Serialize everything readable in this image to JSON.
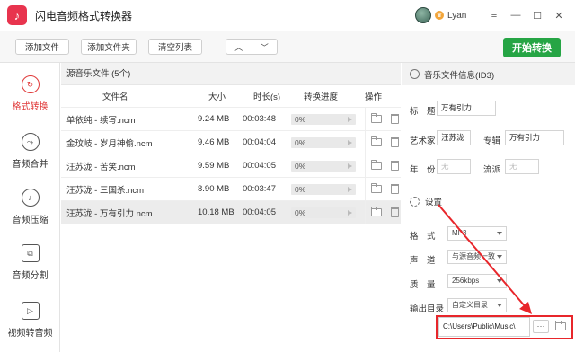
{
  "app": {
    "title": "闪电音频格式转换器",
    "logo_glyph": "♪",
    "accent": "#e8344e"
  },
  "user": {
    "name": "Lyan",
    "vip_glyph": "♛"
  },
  "window": {
    "minimize": "—",
    "restore": "☐",
    "close": "✕",
    "menu": "≡"
  },
  "toolbar": {
    "add_file": "添加文件",
    "add_folder": "添加文件夹",
    "clear_list": "清空列表",
    "move_up": "︿",
    "move_down": "﹀",
    "start": "开始转换",
    "start_color": "#26a545"
  },
  "sidebar": {
    "items": [
      {
        "label": "格式转换",
        "icon": "refresh-icon",
        "glyph": "↻",
        "active": true
      },
      {
        "label": "音频合并",
        "icon": "merge-icon",
        "glyph": "⤳",
        "active": false
      },
      {
        "label": "音频压缩",
        "icon": "compress-icon",
        "glyph": "♪",
        "active": false
      },
      {
        "label": "音频分割",
        "icon": "split-icon",
        "glyph": "⧉",
        "active": false
      },
      {
        "label": "视频转音频",
        "icon": "video-icon",
        "glyph": "▷",
        "active": false
      }
    ]
  },
  "list": {
    "header": "源音乐文件 (5个)",
    "columns": {
      "name": "文件名",
      "size": "大小",
      "duration": "时长(s)",
      "progress": "转换进度",
      "ops": "操作"
    },
    "rows": [
      {
        "name": "单依纯 - 续写.ncm",
        "size": "9.24 MB",
        "duration": "00:03:48",
        "progress": "0%"
      },
      {
        "name": "金玟岐 - 岁月神偷.ncm",
        "size": "9.46 MB",
        "duration": "00:04:04",
        "progress": "0%"
      },
      {
        "name": "汪苏泷 - 苦笑.ncm",
        "size": "9.59 MB",
        "duration": "00:04:05",
        "progress": "0%"
      },
      {
        "name": "汪苏泷 - 三国杀.ncm",
        "size": "8.90 MB",
        "duration": "00:03:47",
        "progress": "0%"
      },
      {
        "name": "汪苏泷 - 万有引力.ncm",
        "size": "10.18 MB",
        "duration": "00:04:05",
        "progress": "0%"
      }
    ]
  },
  "info": {
    "header": "音乐文件信息(ID3)",
    "title_label": "标　题",
    "title_value": "万有引力",
    "artist_label": "艺术家",
    "artist_value": "汪苏泷",
    "album_label": "专辑",
    "album_value": "万有引力",
    "year_label": "年　份",
    "year_value": "无",
    "genre_label": "流派",
    "genre_value": "无"
  },
  "settings": {
    "header": "设置",
    "format_label": "格　式",
    "format_value": "MP3",
    "channel_label": "声　道",
    "channel_value": "与源音频一致",
    "quality_label": "质　量",
    "quality_value": "256kbps",
    "output_label": "输出目录",
    "output_value": "自定义目录",
    "path_value": "C:\\Users\\Public\\Music\\",
    "browse": "···"
  }
}
